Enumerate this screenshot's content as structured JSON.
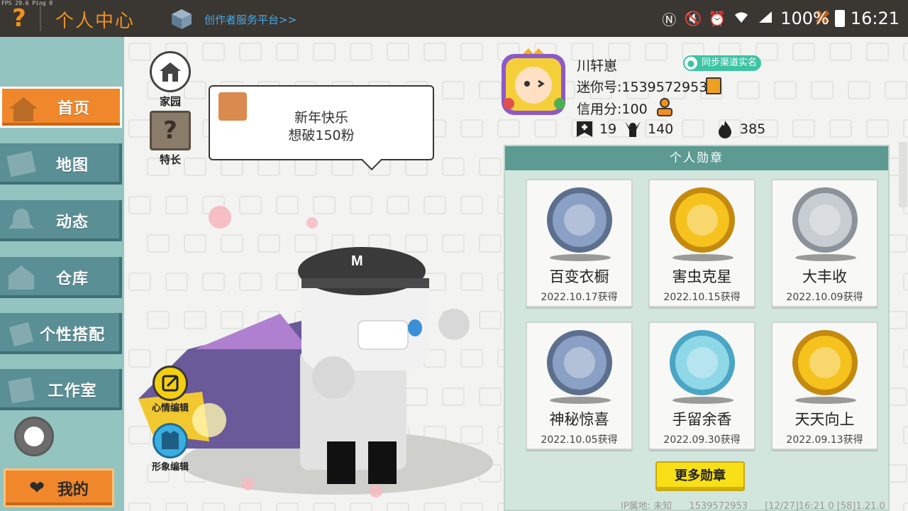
{
  "system": {
    "fps": "FPS 29.6  Ping 0",
    "battery": "100%",
    "time": "16:21"
  },
  "header": {
    "title": "个人中心",
    "creator_link": "创作者服务平台>>"
  },
  "sidebar": {
    "items": [
      {
        "label": "首页",
        "icon": "home-icon",
        "active": true
      },
      {
        "label": "地图",
        "icon": "map-icon",
        "active": false
      },
      {
        "label": "动态",
        "icon": "bell-icon",
        "active": false
      },
      {
        "label": "仓库",
        "icon": "warehouse-icon",
        "active": false
      },
      {
        "label": "个性搭配",
        "icon": "outfit-icon",
        "active": false
      },
      {
        "label": "工作室",
        "icon": "studio-icon",
        "active": false
      }
    ],
    "mine_label": "我的"
  },
  "main": {
    "home_label": "家园",
    "skill_label": "特长",
    "skill_glyph": "?",
    "speech_line1": "新年快乐",
    "speech_line2": "想破150粉",
    "mood_edit_label": "心情编辑",
    "look_edit_label": "形象编辑"
  },
  "profile": {
    "name": "川轩崽",
    "sync_badge": "同步渠道实名",
    "mini_id": "迷你号:1539572953",
    "credit": "信用分:100",
    "stats": {
      "follows": "19",
      "fans": "140",
      "popularity": "385"
    }
  },
  "medals": {
    "header": "个人勋章",
    "items": [
      {
        "name": "百变衣橱",
        "date": "2022.10.17获得",
        "color": "#8aa0c4",
        "rim": "#5d6f8e"
      },
      {
        "name": "害虫克星",
        "date": "2022.10.15获得",
        "color": "#f5c21e",
        "rim": "#c48a10"
      },
      {
        "name": "大丰收",
        "date": "2022.10.09获得",
        "color": "#c8cdd2",
        "rim": "#8c9299"
      },
      {
        "name": "神秘惊喜",
        "date": "2022.10.05获得",
        "color": "#8aa0c4",
        "rim": "#5d6f8e"
      },
      {
        "name": "手留余香",
        "date": "2022.09.30获得",
        "color": "#8fd8e8",
        "rim": "#4aa6c4"
      },
      {
        "name": "天天向上",
        "date": "2022.09.13获得",
        "color": "#f5c21e",
        "rim": "#c48a10"
      }
    ],
    "more_button": "更多勋章"
  },
  "footer": {
    "ip_location": "IP属地: 未知",
    "uid": "1539572953",
    "build_info": "[12/27]16:21 0  [58]1.21.0"
  },
  "colors": {
    "accent_orange": "#f0872a",
    "sidebar_teal": "#5b8f96",
    "panel_header": "#5c9a92",
    "button_yellow": "#f8e018"
  }
}
